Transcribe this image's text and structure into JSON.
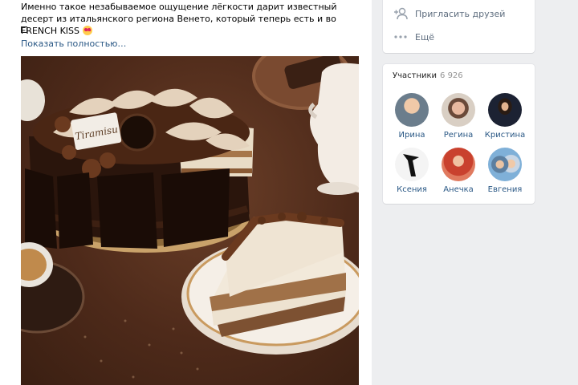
{
  "post": {
    "text": "Именно такое незабываемое ощущение лёгкости дарит известный десерт из итальянского региона Венето, который теперь есть и во FRENCH KISS",
    "emoji": "heart-eyes-emoji",
    "show_more": "Показать полностью…",
    "photo": {
      "subject": "tiramisu-cake-photo",
      "cake_label": "Tiramisu"
    }
  },
  "actions": [
    {
      "label": "Пригласить друзей",
      "icon": "invite-friends-icon"
    },
    {
      "label": "Ещё",
      "icon": "more-dots-icon"
    }
  ],
  "members": {
    "title": "Участники",
    "count": "6 926",
    "list": [
      {
        "name": "Ирина",
        "avatar_color": "#8aa1b3"
      },
      {
        "name": "Регина",
        "avatar_color": "#c9a88c"
      },
      {
        "name": "Кристина",
        "avatar_color": "#2b2f3a"
      },
      {
        "name": "Ксения",
        "avatar_color": "#f2f2f2"
      },
      {
        "name": "Анечка",
        "avatar_color": "#c65a3d"
      },
      {
        "name": "Евгения",
        "avatar_color": "#6f9dc4"
      }
    ]
  },
  "colors": {
    "link": "#2a5885",
    "background": "#edeef0",
    "secondary_text": "#5f6e7f"
  }
}
